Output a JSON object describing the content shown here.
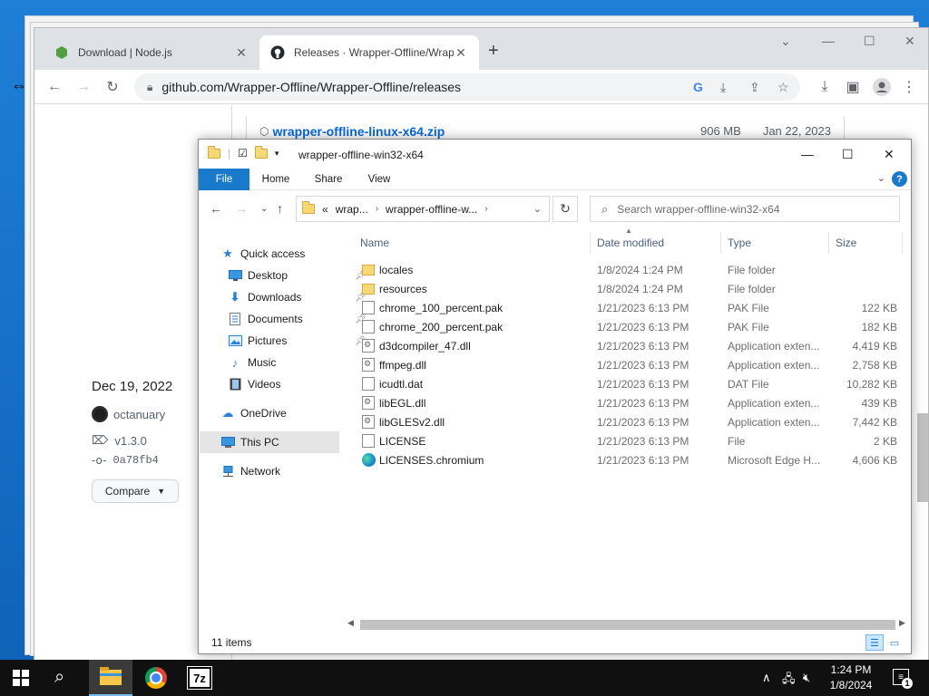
{
  "browser": {
    "tabs": [
      {
        "label": "Download | Node.js",
        "active": false,
        "icon": "nodejs-icon"
      },
      {
        "label": "Releases · Wrapper-Offline/Wrap",
        "active": true,
        "icon": "github-icon"
      }
    ],
    "url": "github.com/Wrapper-Offline/Wrapper-Offline/releases"
  },
  "github": {
    "asset": {
      "name": "wrapper-offline-linux-x64.zip",
      "size": "906 MB",
      "date": "Jan 22, 2023"
    },
    "release_date": "Dec 19, 2022",
    "author": "octanuary",
    "tag": "v1.3.0",
    "commit": "0a78fb4",
    "compare_label": "Compare"
  },
  "explorer": {
    "title": "wrapper-offline-win32-x64",
    "ribbon_tabs": [
      "File",
      "Home",
      "Share",
      "View"
    ],
    "address": {
      "prefix": "«",
      "crumbs": [
        "wrap...",
        "wrapper-offline-w..."
      ]
    },
    "search_placeholder": "Search wrapper-offline-win32-x64",
    "nav": {
      "quick_access": "Quick access",
      "quick_items": [
        "Desktop",
        "Downloads",
        "Documents",
        "Pictures",
        "Music",
        "Videos"
      ],
      "onedrive": "OneDrive",
      "this_pc": "This PC",
      "network": "Network"
    },
    "columns": {
      "name": "Name",
      "date": "Date modified",
      "type": "Type",
      "size": "Size"
    },
    "files": [
      {
        "name": "locales",
        "date": "1/8/2024 1:24 PM",
        "type": "File folder",
        "size": "",
        "kind": "folder"
      },
      {
        "name": "resources",
        "date": "1/8/2024 1:24 PM",
        "type": "File folder",
        "size": "",
        "kind": "folder"
      },
      {
        "name": "chrome_100_percent.pak",
        "date": "1/21/2023 6:13 PM",
        "type": "PAK File",
        "size": "122 KB",
        "kind": "doc"
      },
      {
        "name": "chrome_200_percent.pak",
        "date": "1/21/2023 6:13 PM",
        "type": "PAK File",
        "size": "182 KB",
        "kind": "doc"
      },
      {
        "name": "d3dcompiler_47.dll",
        "date": "1/21/2023 6:13 PM",
        "type": "Application exten...",
        "size": "4,419 KB",
        "kind": "dll"
      },
      {
        "name": "ffmpeg.dll",
        "date": "1/21/2023 6:13 PM",
        "type": "Application exten...",
        "size": "2,758 KB",
        "kind": "dll"
      },
      {
        "name": "icudtl.dat",
        "date": "1/21/2023 6:13 PM",
        "type": "DAT File",
        "size": "10,282 KB",
        "kind": "doc"
      },
      {
        "name": "libEGL.dll",
        "date": "1/21/2023 6:13 PM",
        "type": "Application exten...",
        "size": "439 KB",
        "kind": "dll"
      },
      {
        "name": "libGLESv2.dll",
        "date": "1/21/2023 6:13 PM",
        "type": "Application exten...",
        "size": "7,442 KB",
        "kind": "dll"
      },
      {
        "name": "LICENSE",
        "date": "1/21/2023 6:13 PM",
        "type": "File",
        "size": "2 KB",
        "kind": "doc"
      },
      {
        "name": "LICENSES.chromium",
        "date": "1/21/2023 6:13 PM",
        "type": "Microsoft Edge H...",
        "size": "4,606 KB",
        "kind": "edge"
      }
    ],
    "status": "11 items"
  },
  "taskbar": {
    "time": "1:24 PM",
    "date": "1/8/2024",
    "notification_count": "1",
    "seven_zip_label": "7z"
  },
  "colors": {
    "accent": "#1979ca",
    "link": "#0969da",
    "folder": "#f8d775",
    "taskbar": "#101010"
  }
}
